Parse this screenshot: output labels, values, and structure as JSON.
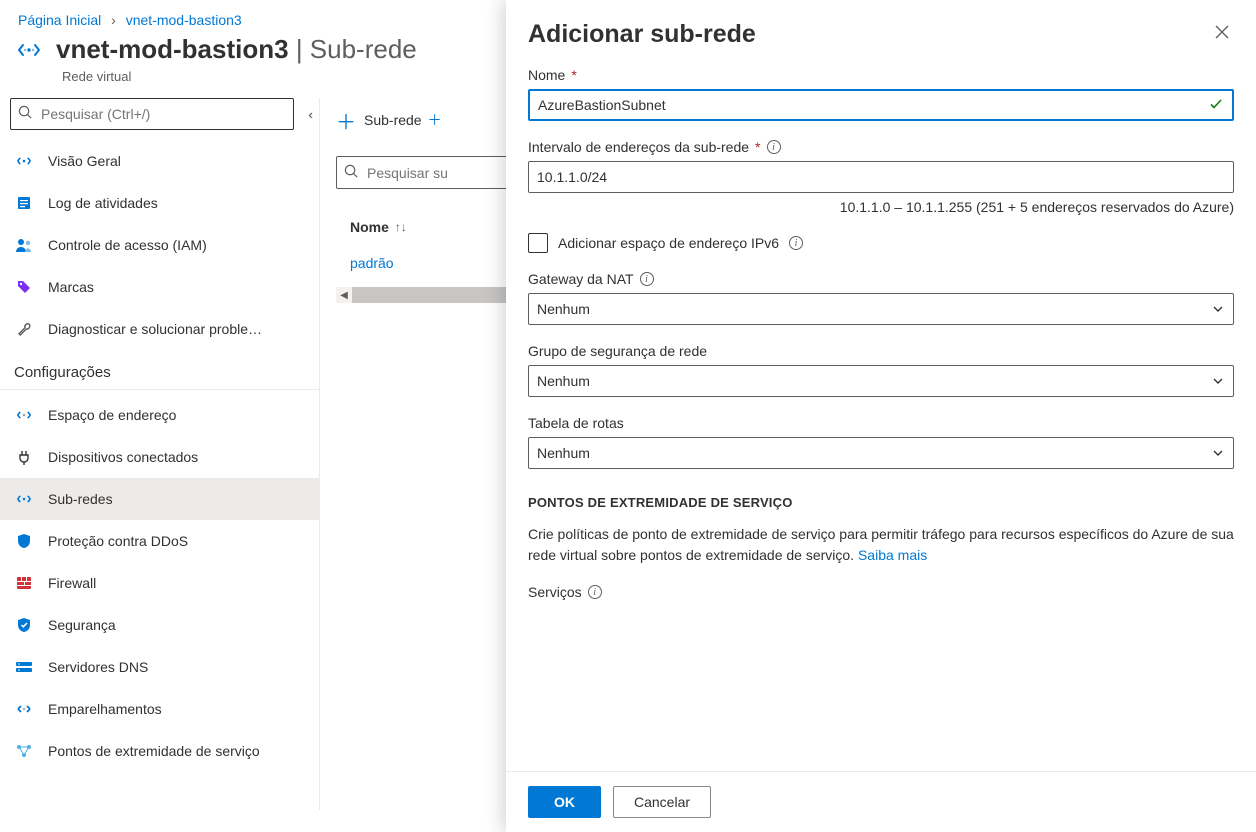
{
  "breadcrumb": {
    "home": "Página Inicial",
    "resource": "vnet-mod-bastion3"
  },
  "header": {
    "title": "vnet-mod-bastion3",
    "section": "Sub-rede",
    "subtitle": "Rede virtual"
  },
  "leftnav": {
    "search_placeholder": "Pesquisar (Ctrl+/)",
    "items_top": [
      {
        "id": "overview",
        "label": "Visão Geral",
        "icon": "vnet"
      },
      {
        "id": "activity",
        "label": "Log de atividades",
        "icon": "log"
      },
      {
        "id": "iam",
        "label": "Controle de acesso (IAM)",
        "icon": "people"
      },
      {
        "id": "tags",
        "label": "Marcas",
        "icon": "tag"
      },
      {
        "id": "diag",
        "label": "Diagnosticar e solucionar proble…",
        "icon": "wrench"
      }
    ],
    "section_settings": "Configurações",
    "items_settings": [
      {
        "id": "addrspace",
        "label": "Espaço de endereço",
        "icon": "vnet2"
      },
      {
        "id": "devices",
        "label": "Dispositivos conectados",
        "icon": "plug"
      },
      {
        "id": "subnets",
        "label": "Sub-redes",
        "icon": "vnet",
        "selected": true
      },
      {
        "id": "ddos",
        "label": "Proteção contra DDoS",
        "icon": "shield"
      },
      {
        "id": "firewall",
        "label": "Firewall",
        "icon": "firewall"
      },
      {
        "id": "security",
        "label": "Segurança",
        "icon": "security"
      },
      {
        "id": "dns",
        "label": "Servidores DNS",
        "icon": "dns"
      },
      {
        "id": "peerings",
        "label": "Emparelhamentos",
        "icon": "peer"
      },
      {
        "id": "svcept",
        "label": "Pontos de extremidade de serviço",
        "icon": "endpoints"
      }
    ]
  },
  "mid": {
    "add_subnet": "Sub-rede",
    "search_placeholder": "Pesquisar su",
    "col_name": "Nome",
    "rows": [
      {
        "name": "padrão"
      }
    ]
  },
  "panel": {
    "title": "Adicionar sub-rede",
    "name_label": "Nome",
    "name_value": "AzureBastionSubnet",
    "range_label": "Intervalo de endereços da sub-rede",
    "range_value": "10.1.1.0/24",
    "range_hint": "10.1.1.0 – 10.1.1.255 (251 + 5 endereços reservados do Azure)",
    "ipv6_label": "Adicionar espaço de endereço IPv6",
    "nat_label": "Gateway da NAT",
    "nat_value": "Nenhum",
    "nsg_label": "Grupo de segurança de rede",
    "nsg_value": "Nenhum",
    "route_label": "Tabela de rotas",
    "route_value": "Nenhum",
    "svc_section": "PONTOS DE EXTREMIDADE DE SERVIÇO",
    "svc_desc": "Crie políticas de ponto de extremidade de serviço para permitir tráfego para recursos específicos do Azure de sua rede virtual sobre pontos de extremidade de serviço. ",
    "svc_link": "Saiba mais",
    "svc_label": "Serviços",
    "ok": "OK",
    "cancel": "Cancelar"
  }
}
